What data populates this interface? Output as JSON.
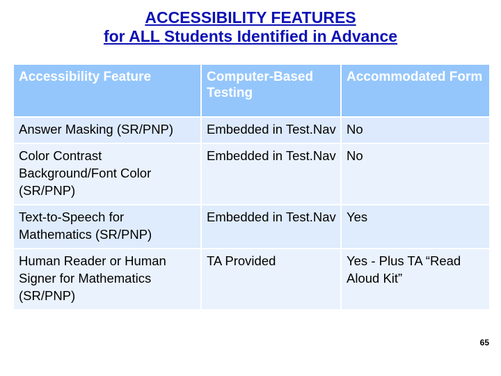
{
  "slide": {
    "title_line1": "ACCESSIBILITY FEATURES",
    "title_line2": "for ALL Students Identified in Advance",
    "title_color": "#0d12b4",
    "page_number": "65",
    "header_bg": "#94c6fc",
    "header_text_color": "#ffffff",
    "body_bg": "#ddeafd",
    "body_text_color": "#000000"
  },
  "table": {
    "columns": [
      "Accessibility Feature",
      "Computer-Based Testing",
      "Accommodated Form"
    ],
    "rows": [
      {
        "feature": "Answer Masking (SR/PNP)",
        "computer_based_testing": "Embedded in Test.Nav",
        "accommodated_form": "No"
      },
      {
        "feature": "Color Contrast Background/Font Color (SR/PNP)",
        "computer_based_testing": "Embedded in Test.Nav",
        "accommodated_form": "No"
      },
      {
        "feature": "Text-to-Speech for Mathematics (SR/PNP)",
        "computer_based_testing": "Embedded in Test.Nav",
        "accommodated_form": "Yes"
      },
      {
        "feature": "Human Reader or Human Signer for Mathematics (SR/PNP)",
        "computer_based_testing": "TA Provided",
        "accommodated_form": "Yes - Plus TA “Read Aloud Kit”"
      }
    ]
  }
}
